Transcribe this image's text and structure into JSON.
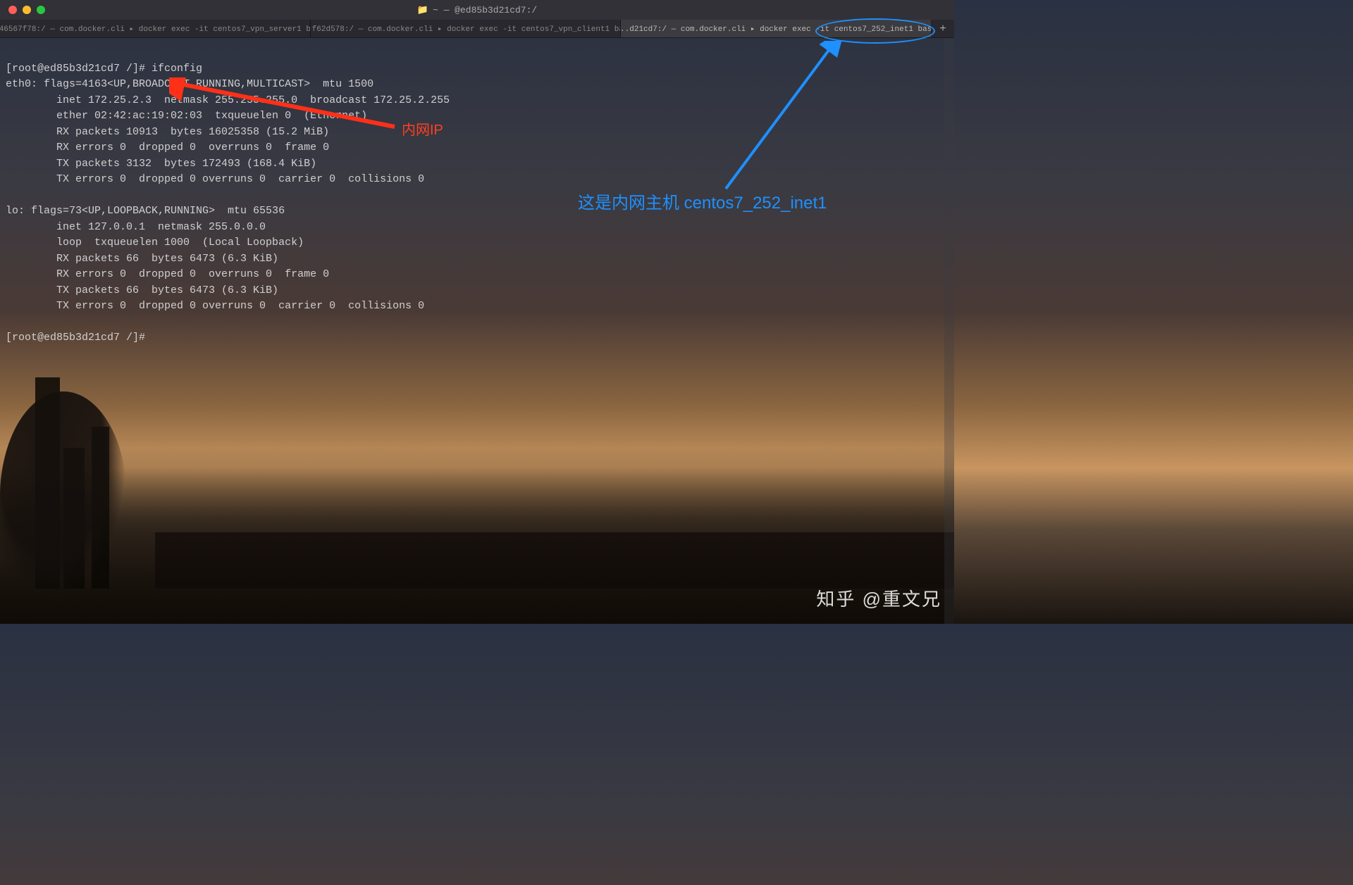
{
  "window": {
    "title": "~ — @ed85b3d21cd7:/"
  },
  "tabs": [
    {
      "label": "...46567f78:/ — com.docker.cli ▸ docker exec -it centos7_vpn_server1 bash",
      "active": false
    },
    {
      "label": "...f62d578:/ — com.docker.cli ▸ docker exec -it centos7_vpn_client1 bash",
      "active": false
    },
    {
      "label": "...d21cd7:/ — com.docker.cli ▸ docker exec -it centos7_252_inet1 bash",
      "active": true
    }
  ],
  "terminal": {
    "line1": "[root@ed85b3d21cd7 /]# ifconfig",
    "line2": "eth0: flags=4163<UP,BROADCAST,RUNNING,MULTICAST>  mtu 1500",
    "line3": "        inet 172.25.2.3  netmask 255.255.255.0  broadcast 172.25.2.255",
    "line4": "        ether 02:42:ac:19:02:03  txqueuelen 0  (Ethernet)",
    "line5": "        RX packets 10913  bytes 16025358 (15.2 MiB)",
    "line6": "        RX errors 0  dropped 0  overruns 0  frame 0",
    "line7": "        TX packets 3132  bytes 172493 (168.4 KiB)",
    "line8": "        TX errors 0  dropped 0 overruns 0  carrier 0  collisions 0",
    "line9": "",
    "line10": "lo: flags=73<UP,LOOPBACK,RUNNING>  mtu 65536",
    "line11": "        inet 127.0.0.1  netmask 255.0.0.0",
    "line12": "        loop  txqueuelen 1000  (Local Loopback)",
    "line13": "        RX packets 66  bytes 6473 (6.3 KiB)",
    "line14": "        RX errors 0  dropped 0  overruns 0  frame 0",
    "line15": "        TX packets 66  bytes 6473 (6.3 KiB)",
    "line16": "        TX errors 0  dropped 0 overruns 0  carrier 0  collisions 0",
    "line17": "",
    "line18": "[root@ed85b3d21cd7 /]#"
  },
  "annotations": {
    "red_label": "内网IP",
    "blue_label": "这是内网主机 centos7_252_inet1"
  },
  "watermark": "知乎 @重文兄"
}
